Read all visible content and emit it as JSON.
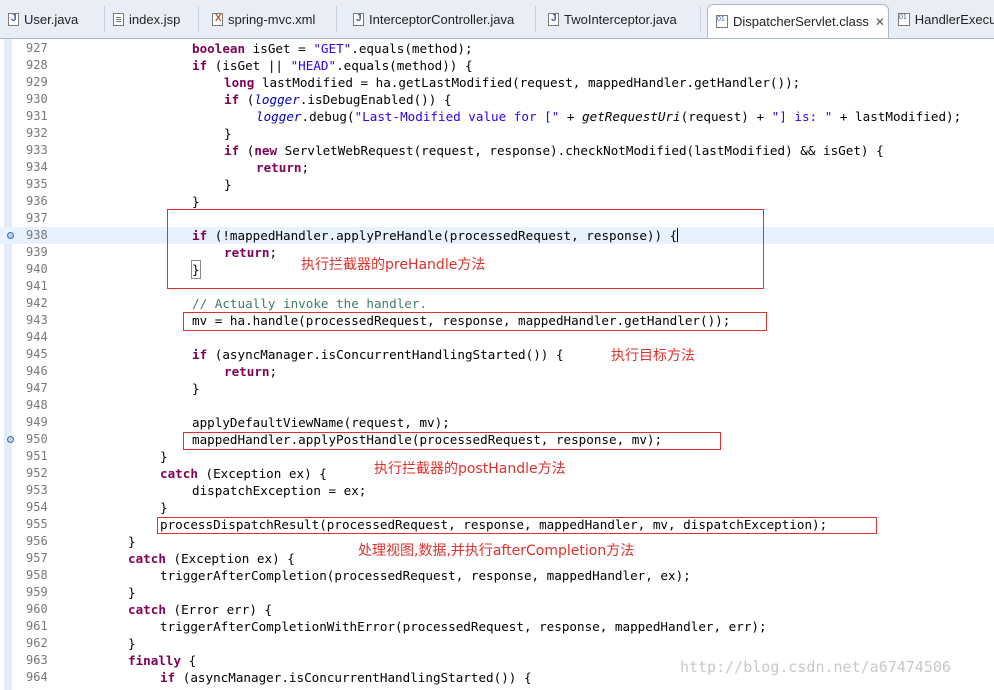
{
  "tabs": [
    {
      "label": "User.java",
      "icon": "java-file-icon"
    },
    {
      "label": "index.jsp",
      "icon": "jsp-file-icon"
    },
    {
      "label": "spring-mvc.xml",
      "icon": "xml-file-icon"
    },
    {
      "label": "InterceptorController.java",
      "icon": "java-file-icon"
    },
    {
      "label": "TwoInterceptor.java",
      "icon": "java-file-icon"
    },
    {
      "label": "DispatcherServlet.class",
      "icon": "class-file-icon",
      "close": "✕"
    },
    {
      "label": "HandlerExecut",
      "icon": "class-file-icon"
    }
  ],
  "lines": {
    "927": "927",
    "928": "928",
    "929": "929",
    "930": "930",
    "931": "931",
    "932": "932",
    "933": "933",
    "934": "934",
    "935": "935",
    "936": "936",
    "937": "937",
    "938": "938",
    "939": "939",
    "940": "940",
    "941": "941",
    "942": "942",
    "943": "943",
    "944": "944",
    "945": "945",
    "946": "946",
    "947": "947",
    "948": "948",
    "949": "949",
    "950": "950",
    "951": "951",
    "952": "952",
    "953": "953",
    "954": "954",
    "955": "955",
    "956": "956",
    "957": "957",
    "958": "958",
    "959": "959",
    "960": "960",
    "961": "961",
    "962": "962",
    "963": "963",
    "964": "964"
  },
  "code": {
    "l927_kw": "boolean",
    "l927_a": " isGet = ",
    "l927_s": "\"GET\"",
    "l927_b": ".equals(method);",
    "l928_kw": "if",
    "l928_a": " (isGet || ",
    "l928_s": "\"HEAD\"",
    "l928_b": ".equals(method)) {",
    "l929_kw": "long",
    "l929_a": " lastModified = ha.getLastModified(request, mappedHandler.getHandler());",
    "l930_kw": "if",
    "l930_a": " (",
    "l930_f": "logger",
    "l930_b": ".isDebugEnabled()) {",
    "l931_f": "logger",
    "l931_a": ".debug(",
    "l931_s": "\"Last-Modified value for [\"",
    "l931_b": " + ",
    "l931_i": "getRequestUri",
    "l931_c": "(request) + ",
    "l931_s2": "\"] is: \"",
    "l931_d": " + lastModified);",
    "l932": "}",
    "l933_kw": "if",
    "l933_a": " (",
    "l933_kw2": "new",
    "l933_b": " ServletWebRequest(request, response).checkNotModified(lastModified) && isGet) {",
    "l934_kw": "return",
    "l934_a": ";",
    "l935": "}",
    "l936": "}",
    "l938_kw": "if",
    "l938_a": " (!mappedHandler.applyPreHandle(processedRequest, response)) {",
    "l939_kw": "return",
    "l939_a": ";",
    "l940": "}",
    "l942_c": "// Actually invoke the handler.",
    "l943": "mv = ha.handle(processedRequest, response, mappedHandler.getHandler());",
    "l945_kw": "if",
    "l945_a": " (asyncManager.isConcurrentHandlingStarted()) {",
    "l946_kw": "return",
    "l946_a": ";",
    "l947": "}",
    "l949": "applyDefaultViewName(request, mv);",
    "l950": "mappedHandler.applyPostHandle(processedRequest, response, mv);",
    "l951": "}",
    "l952_kw": "catch",
    "l952_a": " (Exception ex) {",
    "l953": "dispatchException = ex;",
    "l954": "}",
    "l955": "processDispatchResult(processedRequest, response, mappedHandler, mv, dispatchException);",
    "l956": "}",
    "l957_kw": "catch",
    "l957_a": " (Exception ex) {",
    "l958": "triggerAfterCompletion(processedRequest, response, mappedHandler, ex);",
    "l959": "}",
    "l960_kw": "catch",
    "l960_a": " (Error err) {",
    "l961": "triggerAfterCompletionWithError(processedRequest, response, mappedHandler, err);",
    "l962": "}",
    "l963_kw": "finally",
    "l963_a": " {",
    "l964_kw": "if",
    "l964_a": " (asyncManager.isConcurrentHandlingStarted()) {"
  },
  "annotations": {
    "prehandle": "执行拦截器的preHandle方法",
    "target": "执行目标方法",
    "posthandle": "执行拦截器的postHandle方法",
    "aftercompletion": "处理视图,数据,并执行afterCompletion方法"
  },
  "watermark": "http://blog.csdn.net/a67474506",
  "colors": {
    "annotation": "#e0302b",
    "keyword": "#7f0055",
    "string": "#2a00ff",
    "comment": "#3f7f5f",
    "field": "#0000c0"
  }
}
